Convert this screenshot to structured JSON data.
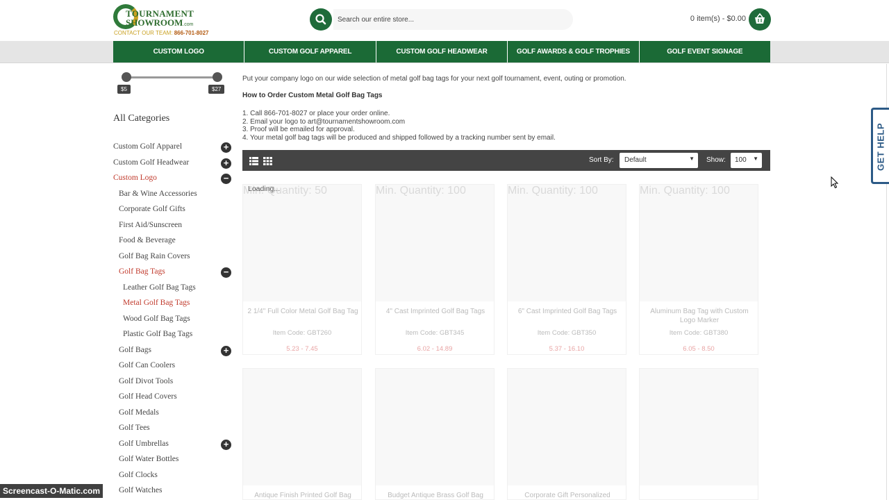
{
  "header": {
    "logo_line1": "TOURNAMENT",
    "logo_line2": "SHOWROOM",
    "logo_suffix": ".com",
    "contact_label": "CONTACT OUR TEAM:",
    "contact_phone": "866-701-8027",
    "search_placeholder": "Search our entire store...",
    "cart_text": "0 item(s) - $0.00"
  },
  "nav": [
    "CUSTOM LOGO",
    "CUSTOM GOLF APPAREL",
    "CUSTOM GOLF HEADWEAR",
    "GOLF AWARDS & GOLF TROPHIES",
    "GOLF EVENT SIGNAGE"
  ],
  "price_filter": {
    "min": "$5",
    "max": "$27"
  },
  "sidebar": {
    "title": "All Categories",
    "items": [
      {
        "label": "Custom Golf Apparel",
        "level": 0,
        "toggle": "+",
        "active": false
      },
      {
        "label": "Custom Golf Headwear",
        "level": 0,
        "toggle": "+",
        "active": false
      },
      {
        "label": "Custom Logo",
        "level": 0,
        "toggle": "−",
        "active": true
      },
      {
        "label": "Bar & Wine Accessories",
        "level": 1,
        "toggle": "",
        "active": false
      },
      {
        "label": "Corporate Golf Gifts",
        "level": 1,
        "toggle": "",
        "active": false
      },
      {
        "label": "First Aid/Sunscreen",
        "level": 1,
        "toggle": "",
        "active": false
      },
      {
        "label": "Food & Beverage",
        "level": 1,
        "toggle": "",
        "active": false
      },
      {
        "label": "Golf Bag Rain Covers",
        "level": 1,
        "toggle": "",
        "active": false
      },
      {
        "label": "Golf Bag Tags",
        "level": 1,
        "toggle": "−",
        "active": true
      },
      {
        "label": "Leather Golf Bag Tags",
        "level": 2,
        "toggle": "",
        "active": false
      },
      {
        "label": "Metal Golf Bag Tags",
        "level": 2,
        "toggle": "",
        "active": true
      },
      {
        "label": "Wood Golf Bag Tags",
        "level": 2,
        "toggle": "",
        "active": false
      },
      {
        "label": "Plastic Golf Bag Tags",
        "level": 2,
        "toggle": "",
        "active": false
      },
      {
        "label": "Golf Bags",
        "level": 1,
        "toggle": "+",
        "active": false
      },
      {
        "label": "Golf Can Coolers",
        "level": 1,
        "toggle": "",
        "active": false
      },
      {
        "label": "Golf Divot Tools",
        "level": 1,
        "toggle": "",
        "active": false
      },
      {
        "label": "Golf Head Covers",
        "level": 1,
        "toggle": "",
        "active": false
      },
      {
        "label": "Golf Medals",
        "level": 1,
        "toggle": "",
        "active": false
      },
      {
        "label": "Golf Tees",
        "level": 1,
        "toggle": "",
        "active": false
      },
      {
        "label": "Golf Umbrellas",
        "level": 1,
        "toggle": "+",
        "active": false
      },
      {
        "label": "Golf Water Bottles",
        "level": 1,
        "toggle": "",
        "active": false
      },
      {
        "label": "Golf Clocks",
        "level": 1,
        "toggle": "",
        "active": false
      },
      {
        "label": "Golf Watches",
        "level": 1,
        "toggle": "",
        "active": false
      }
    ]
  },
  "main": {
    "intro": "Put your company logo on our wide selection of metal golf bag tags for your next golf tournament, event, outing or promotion.",
    "howto_title": "How to Order Custom Metal Golf Bag Tags",
    "steps": [
      "1. Call 866-701-8027 or place your order online.",
      "2. Email your logo to art@tournamentshowroom.com",
      "3. Proof will be emailed for approval.",
      "4. Your metal golf bag tags will be produced and shipped followed by a tracking number sent by email."
    ],
    "sort_label": "Sort By:",
    "sort_value": "Default",
    "show_label": "Show:",
    "show_value": "100",
    "loading": "Loading..."
  },
  "products": [
    {
      "name": "2 1/4\" Full Color Metal Golf Bag Tag",
      "code": "Item Code: GBT260",
      "min": "Min. Quantity: 50",
      "price": "5.23 - 7.45"
    },
    {
      "name": "4\" Cast Imprinted Golf Bag Tags",
      "code": "Item Code: GBT345",
      "min": "Min. Quantity: 100",
      "price": "6.02 - 14.89"
    },
    {
      "name": "6\" Cast Imprinted Golf Bag Tags",
      "code": "Item Code: GBT350",
      "min": "Min. Quantity: 100",
      "price": "5.37 - 16.10"
    },
    {
      "name": "Aluminum Bag Tag with Custom Logo Marker",
      "code": "Item Code: GBT380",
      "min": "Min. Quantity: 100",
      "price": "6.05 - 8.50"
    },
    {
      "name": "Antique Finish Printed Golf Bag",
      "code": "",
      "min": "",
      "price": ""
    },
    {
      "name": "Budget Antique Brass Golf Bag",
      "code": "",
      "min": "",
      "price": ""
    },
    {
      "name": "Corporate Gift Personalized",
      "code": "",
      "min": "",
      "price": ""
    },
    {
      "name": "",
      "code": "",
      "min": "",
      "price": ""
    }
  ],
  "get_help": "GET HELP",
  "watermark": "Screencast-O-Matic.com",
  "colors": {
    "brand_green": "#1b6a36",
    "active_red": "#c0392b",
    "help_blue": "#2c5a86"
  }
}
